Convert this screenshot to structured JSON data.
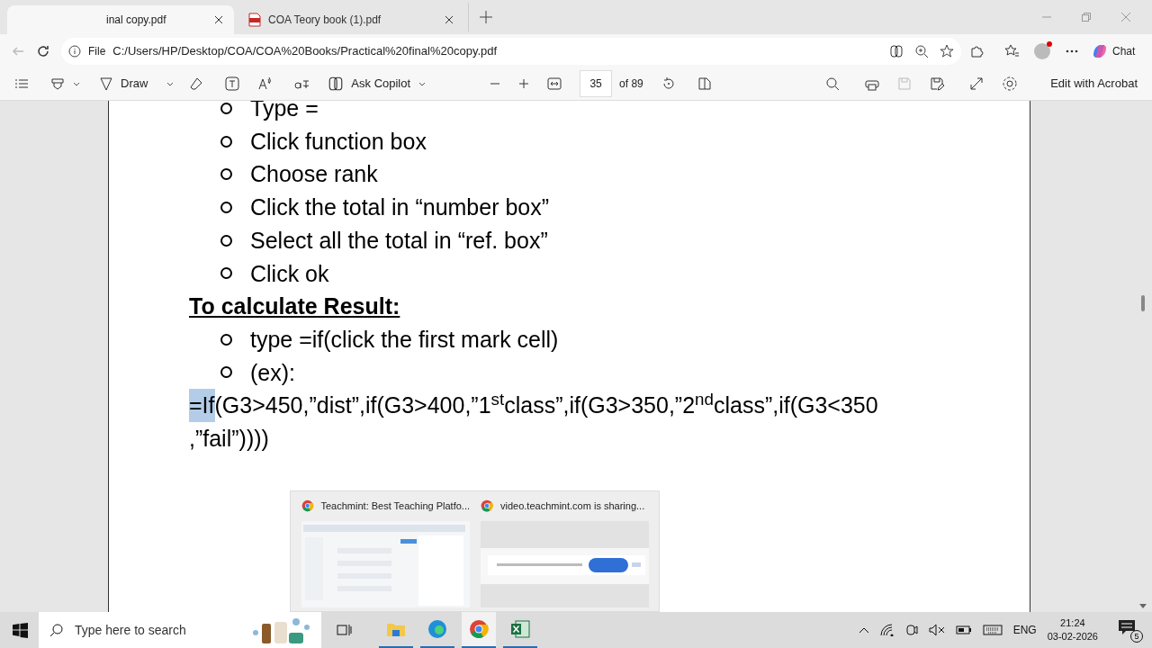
{
  "tabs": [
    {
      "label": "inal copy.pdf",
      "selected": true,
      "kind": "page"
    },
    {
      "label": "COA Teory book (1).pdf",
      "selected": false,
      "kind": "pdf"
    }
  ],
  "address": {
    "scheme": "File",
    "url": "C:/Users/HP/Desktop/COA/COA%20Books/Practical%20final%20copy.pdf"
  },
  "chat_label": "Chat",
  "pdf_toolbar": {
    "draw": "Draw",
    "copilot": "Ask Copilot",
    "page": "35",
    "page_count": "of 89",
    "acrobat": "Edit with Acrobat"
  },
  "document": {
    "steps_top": [
      "Type =",
      "Click function box",
      "Choose rank",
      "Click the total in “number box”",
      "Select all the total in “ref. box”",
      "Click ok"
    ],
    "heading": "To calculate Result:",
    "steps_bottom": [
      "type =if(click the first mark cell)",
      "(ex):"
    ],
    "formula": {
      "highlighted": "=If",
      "rest": "(G3>450,”dist”,if(G3>400,”1$^{st}$class”,if(G3>350,”2$^{nd}$class”,if(G3<350",
      "line_2": ",”fail”))))"
    }
  },
  "taskbar_preview": [
    {
      "title": "Teachmint: Best Teaching Platfo..."
    },
    {
      "title": "video.teachmint.com is sharing..."
    }
  ],
  "taskbar": {
    "search_placeholder": "Type here to search",
    "language": "ENG",
    "time": "21:24",
    "date": "03-02-2026",
    "notifications": "5"
  }
}
